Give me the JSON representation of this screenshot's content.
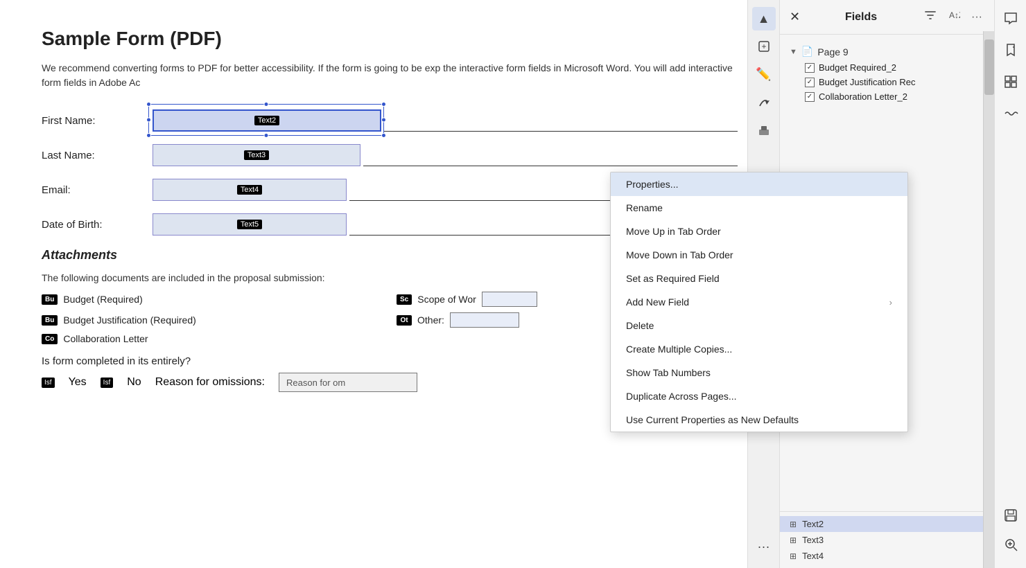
{
  "document": {
    "title": "Sample Form (PDF)",
    "description": "We recommend converting forms to PDF for better accessibility. If the form is going to be exp the interactive form fields in Microsoft Word. You will add interactive form fields in Adobe Ac",
    "fields": [
      {
        "label": "First Name:",
        "badge": "Text2",
        "selected": true
      },
      {
        "label": "Last Name:",
        "badge": "Text3",
        "selected": false
      },
      {
        "label": "Email:",
        "badge": "Text4",
        "selected": false
      },
      {
        "label": "Date of Birth:",
        "badge": "Text5",
        "selected": false
      }
    ],
    "attachments_title": "Attachments",
    "attachments_desc": "The following documents are included in the proposal submission:",
    "attachments": [
      {
        "badge": "Bu",
        "text": "Budget (Required)"
      },
      {
        "badge": "Sc",
        "text": "Scope of Wor"
      },
      {
        "badge": "Bu",
        "text": "Budget Justification (Required)"
      },
      {
        "badge": "Ot",
        "text": "Other:"
      },
      {
        "badge": "Co",
        "text": "Collaboration Letter"
      }
    ],
    "question": "Is form completed in its entirely?",
    "yes_label": "Yes",
    "no_label": "No",
    "reason_label": "Reason for omissions:",
    "reason_placeholder": "Reason for om"
  },
  "sidebar": {
    "title": "Fields",
    "page_label": "Page 9",
    "fields": [
      {
        "name": "Budget Required_2",
        "checked": true
      },
      {
        "name": "Budget Justification Rec",
        "checked": true
      },
      {
        "name": "Collaboration Letter_2",
        "checked": true
      }
    ],
    "bottom_fields": [
      {
        "name": "Text2",
        "selected": true
      },
      {
        "name": "Text3",
        "selected": false
      },
      {
        "name": "Text4",
        "selected": false
      }
    ]
  },
  "context_menu": {
    "items": [
      {
        "label": "Properties...",
        "highlighted": true,
        "has_arrow": false
      },
      {
        "label": "Rename",
        "highlighted": false,
        "has_arrow": false
      },
      {
        "label": "Move Up in Tab Order",
        "highlighted": false,
        "has_arrow": false
      },
      {
        "label": "Move Down in Tab Order",
        "highlighted": false,
        "has_arrow": false
      },
      {
        "label": "Set as Required Field",
        "highlighted": false,
        "has_arrow": false
      },
      {
        "label": "Add New Field",
        "highlighted": false,
        "has_arrow": true
      },
      {
        "label": "Delete",
        "highlighted": false,
        "has_arrow": false
      },
      {
        "label": "Create Multiple Copies...",
        "highlighted": false,
        "has_arrow": false
      },
      {
        "label": "Show Tab Numbers",
        "highlighted": false,
        "has_arrow": false
      },
      {
        "label": "Duplicate Across Pages...",
        "highlighted": false,
        "has_arrow": false
      },
      {
        "label": "Use Current Properties as New Defaults",
        "highlighted": false,
        "has_arrow": false
      }
    ]
  },
  "toolbar": {
    "cursor_icon": "▲",
    "addfield_icon": "+⊞",
    "pencil_icon": "✏",
    "curve_icon": "↺",
    "stamp_icon": "⬛"
  },
  "right_panel": {
    "comment_icon": "💬",
    "bookmark_icon": "🔖",
    "grid_icon": "⊞",
    "wavy_icon": "∿",
    "save_icon": "💾",
    "zoom_icon": "⊕"
  }
}
